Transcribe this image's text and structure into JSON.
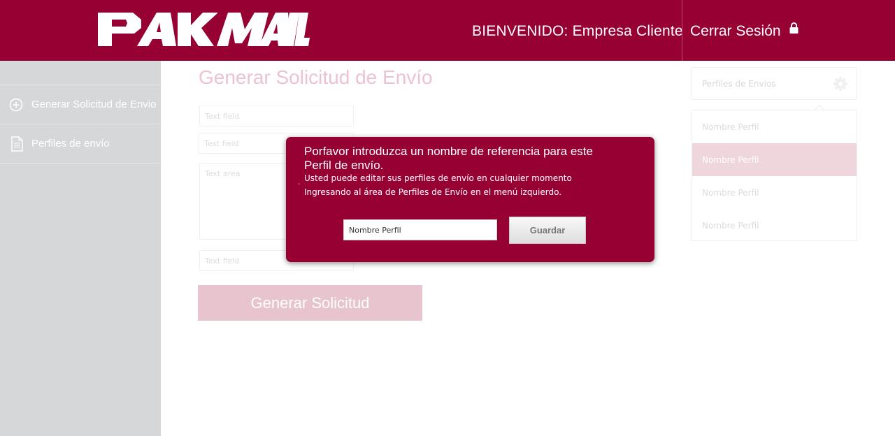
{
  "header": {
    "logo_text": "PAKMAIL",
    "welcome_label": "BIENVENIDO:",
    "user_name": "Empresa Cliente",
    "logout_label": "Cerrar Sesión"
  },
  "sidebar": {
    "items": [
      {
        "label": "Generar Solicitud de Envio",
        "icon": "add-circle-icon"
      },
      {
        "label": "Perfiles de envío",
        "icon": "document-icon"
      }
    ]
  },
  "main": {
    "title": "Generar Solicitud de Envío",
    "fields": {
      "field1_placeholder": "Text field",
      "field2_placeholder": "Text field",
      "textarea_placeholder": "Text area",
      "field3_placeholder": "Text field"
    },
    "submit_label": "Generar Solicitud"
  },
  "profiles_panel": {
    "header_label": "Perfiles de Envios",
    "items": [
      "Nombre Perfil",
      "Nombre Perfil",
      "Nombre Perfil",
      "Nombre Perfil"
    ],
    "active_index": 1
  },
  "modal": {
    "title": "Porfavor introduzca un nombre de referencia  para este Perfil de envío.",
    "desc_line1": "Usted puede editar sus perfiles de envío en cualquier momento",
    "desc_line2": "Ingresando al área de Perfiles de Envío en el menú izquierdo.",
    "dot": "`",
    "input_value": "Nombre Perfil",
    "save_label": "Guardar"
  },
  "colors": {
    "brand": "#970032",
    "sidebar_bg": "#d6d7d9",
    "faded_brand": "#e8c4cf"
  }
}
